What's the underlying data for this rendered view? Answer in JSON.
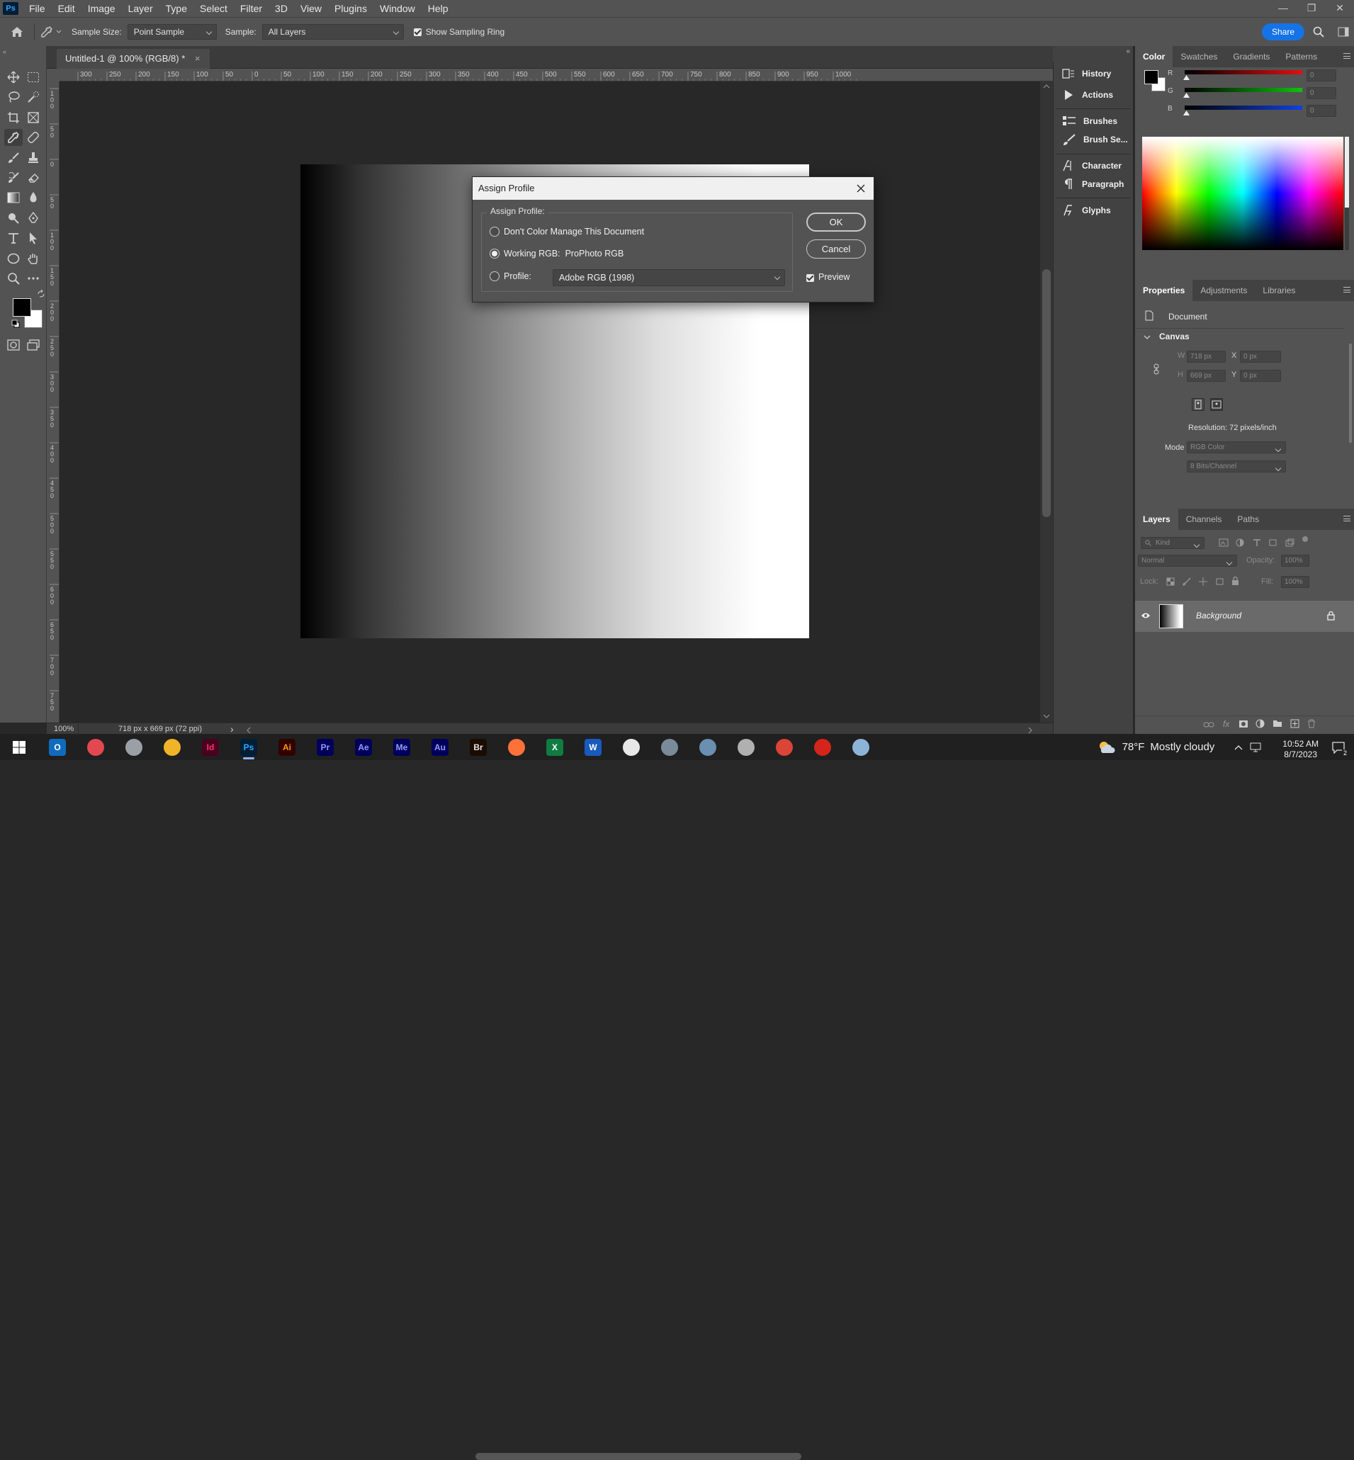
{
  "app": {
    "logo_text": "Ps",
    "accent": "#31a8ff"
  },
  "menubar": {
    "items": [
      "File",
      "Edit",
      "Image",
      "Layer",
      "Type",
      "Select",
      "Filter",
      "3D",
      "View",
      "Plugins",
      "Window",
      "Help"
    ]
  },
  "window_controls": [
    "—",
    "❐",
    "✕"
  ],
  "options_bar": {
    "sample_size_label": "Sample Size:",
    "sample_size_value": "Point Sample",
    "sample_label": "Sample:",
    "sample_value": "All Layers",
    "show_sampling_ring_label": "Show Sampling Ring",
    "show_sampling_ring_checked": true,
    "share_label": "Share",
    "share_color": "#1473e6"
  },
  "document": {
    "tab_title": "Untitled-1 @ 100% (RGB/8) *",
    "tab_close": "×",
    "zoom": "100%",
    "info": "718 px x 669 px (72 ppi)",
    "status_arrow": "›"
  },
  "rulers": {
    "horizontal_ticks": [
      "300",
      "250",
      "200",
      "150",
      "100",
      "50",
      "0",
      "50",
      "100",
      "150",
      "200",
      "250",
      "300",
      "350",
      "400",
      "450",
      "500",
      "550",
      "600",
      "650",
      "700",
      "750",
      "800",
      "850",
      "900",
      "950",
      "1000"
    ],
    "vertical_ticks": [
      "1\n0\n0",
      "5\n0",
      "0",
      "5\n0",
      "1\n0\n0",
      "1\n5\n0",
      "2\n0\n0",
      "2\n5\n0",
      "3\n0\n0",
      "3\n5\n0",
      "4\n0\n0",
      "4\n5\n0",
      "5\n0\n0",
      "5\n5\n0",
      "6\n0\n0",
      "6\n5\n0",
      "7\n0\n0",
      "7\n5\n0"
    ]
  },
  "collapsed_panels": [
    {
      "label": "History",
      "icon": "history-icon"
    },
    {
      "label": "Actions",
      "icon": "actions-play-icon"
    },
    {
      "label": "Brushes",
      "icon": "brushes-icon"
    },
    {
      "label": "Brush Se...",
      "icon": "brush-settings-icon"
    },
    {
      "label": "Character",
      "icon": "character-icon"
    },
    {
      "label": "Paragraph",
      "icon": "paragraph-icon"
    },
    {
      "label": "Glyphs",
      "icon": "glyphs-icon"
    }
  ],
  "color_panel": {
    "tabs": [
      "Color",
      "Swatches",
      "Gradients",
      "Patterns"
    ],
    "active_tab": "Color",
    "channels": [
      {
        "label": "R",
        "value": "0",
        "color": "#e01010"
      },
      {
        "label": "G",
        "value": "0",
        "color": "#10c010"
      },
      {
        "label": "B",
        "value": "0",
        "color": "#1040e0"
      }
    ]
  },
  "properties_panel": {
    "tabs": [
      "Properties",
      "Adjustments",
      "Libraries"
    ],
    "active_tab": "Properties",
    "doc_label": "Document",
    "canvas_label": "Canvas",
    "w_label": "W",
    "w_value": "718 px",
    "h_label": "H",
    "h_value": "669 px",
    "x_label": "X",
    "x_value": "0 px",
    "y_label": "Y",
    "y_value": "0 px",
    "resolution": "Resolution: 72 pixels/inch",
    "mode_label": "Mode",
    "mode_value": "RGB Color",
    "bits_value": "8 Bits/Channel"
  },
  "layers_panel": {
    "tabs": [
      "Layers",
      "Channels",
      "Paths"
    ],
    "active_tab": "Layers",
    "filter_placeholder": "Kind",
    "blend_mode": "Normal",
    "opacity_label": "Opacity:",
    "opacity_value": "100%",
    "lock_label": "Lock:",
    "fill_label": "Fill:",
    "fill_value": "100%",
    "layers": [
      {
        "name": "Background",
        "visible": true,
        "locked": true
      }
    ]
  },
  "dialog": {
    "title": "Assign Profile",
    "group_label": "Assign Profile:",
    "options": [
      {
        "label": "Don't Color Manage This Document",
        "selected": false
      },
      {
        "label": "Working RGB:  ProPhoto RGB",
        "selected": true
      },
      {
        "label": "Profile:",
        "selected": false
      }
    ],
    "profile_value": "Adobe RGB (1998)",
    "ok_label": "OK",
    "cancel_label": "Cancel",
    "preview_label": "Preview",
    "preview_checked": true
  },
  "taskbar": {
    "apps": [
      {
        "name": "start-icon",
        "active": false
      },
      {
        "name": "outlook-icon",
        "active": false,
        "text": "O",
        "bg": "#0f6cbd"
      },
      {
        "name": "creative-cloud-icon",
        "active": false,
        "text": "",
        "bg": "#e34850"
      },
      {
        "name": "fresco-icon",
        "active": false,
        "text": "",
        "bg": "#9aa0a6"
      },
      {
        "name": "file-explorer-icon",
        "active": false,
        "text": "",
        "bg": "#f0b429"
      },
      {
        "name": "indesign-icon",
        "active": false,
        "text": "Id",
        "bg": "#49021f",
        "fg": "#ff3366"
      },
      {
        "name": "photoshop-icon",
        "active": true,
        "text": "Ps",
        "bg": "#001e36",
        "fg": "#31a8ff"
      },
      {
        "name": "illustrator-icon",
        "active": false,
        "text": "Ai",
        "bg": "#330000",
        "fg": "#ff9a00"
      },
      {
        "name": "premiere-icon",
        "active": false,
        "text": "Pr",
        "bg": "#00005b",
        "fg": "#9999ff"
      },
      {
        "name": "after-effects-icon",
        "active": false,
        "text": "Ae",
        "bg": "#00005b",
        "fg": "#9999ff"
      },
      {
        "name": "media-encoder-icon",
        "active": false,
        "text": "Me",
        "bg": "#00005b",
        "fg": "#9999ff"
      },
      {
        "name": "audition-icon",
        "active": false,
        "text": "Au",
        "bg": "#00005b",
        "fg": "#9999ff"
      },
      {
        "name": "bridge-icon",
        "active": false,
        "text": "Br",
        "bg": "#1a0c00",
        "fg": "#e6e6e6"
      },
      {
        "name": "firefox-icon",
        "active": false,
        "text": "",
        "bg": "#ff7139"
      },
      {
        "name": "excel-icon",
        "active": false,
        "text": "X",
        "bg": "#107c41"
      },
      {
        "name": "word-icon",
        "active": false,
        "text": "W",
        "bg": "#185abd"
      },
      {
        "name": "slack-icon",
        "active": false,
        "text": "",
        "bg": "#e8e8e8"
      },
      {
        "name": "network-icon",
        "active": false,
        "text": "",
        "bg": "#7a8a99"
      },
      {
        "name": "calculator-icon",
        "active": false,
        "text": "",
        "bg": "#6a8fb0"
      },
      {
        "name": "disk-icon",
        "active": false,
        "text": "",
        "bg": "#b0b0b0"
      },
      {
        "name": "chrome-icon",
        "active": false,
        "text": "",
        "bg": "#db4437"
      },
      {
        "name": "acrobat-icon",
        "active": false,
        "text": "",
        "bg": "#d4241b"
      },
      {
        "name": "notepad-icon",
        "active": false,
        "text": "",
        "bg": "#8cb4d8"
      }
    ],
    "weather_temp": "78°F",
    "weather_desc": "Mostly cloudy",
    "time": "10:52 AM",
    "date": "8/7/2023",
    "notification_count": "2"
  }
}
